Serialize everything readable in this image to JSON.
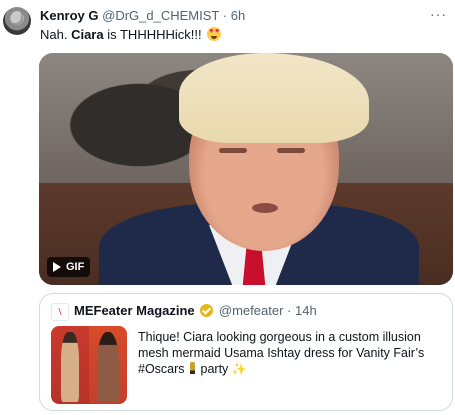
{
  "tweet": {
    "author_name": "Kenroy G",
    "author_handle": "@DrG_d_CHEMIST",
    "separator": "·",
    "time": "6h",
    "more_label": "···",
    "text_prefix": "Nah. ",
    "text_bold": "Ciara",
    "text_suffix": " is THHHHHick!!! ",
    "text_emoji": "smiling-face-with-heart-eyes"
  },
  "media": {
    "badge_label": "GIF",
    "badge_icon": "play-icon"
  },
  "quote": {
    "avatar_letter": "\\",
    "author_name": "MEFeater Magazine",
    "verified_icon": "verified-gold-icon",
    "author_handle": "@mefeater",
    "separator": "·",
    "time": "14h",
    "text_line1": "Thique! Ciara looking gorgeous in a custom illusion",
    "text_line2": "mesh mermaid Usama Ishtay dress for Vanity Fair’s",
    "text_line3_a": "#Oscars",
    "text_line3_b": " party ",
    "text_icons": [
      "trophy-icon",
      "sparkles-icon"
    ]
  },
  "colors": {
    "text": "#0f1419",
    "secondary": "#536471",
    "border": "#cfd9de",
    "verified_gold": "#e2b719"
  }
}
